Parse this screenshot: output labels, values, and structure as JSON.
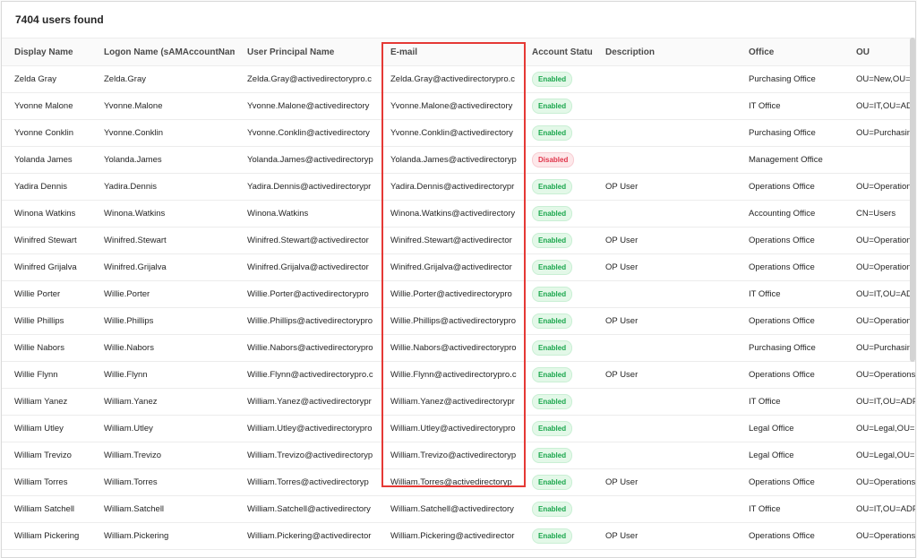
{
  "header": {
    "results_count": "7404 users found"
  },
  "columns": [
    "Display Name",
    "Logon Name (sAMAccountName",
    "User Principal Name",
    "E-mail",
    "Account Statu",
    "Description",
    "Office",
    "OU"
  ],
  "colors": {
    "highlight": "#e53935",
    "enabled": "#1aa64c",
    "disabled": "#e0354b"
  },
  "rows": [
    {
      "display": "Zelda Gray",
      "logon": "Zelda.Gray",
      "upn": "Zelda.Gray@activedirectorypro.c",
      "email": "Zelda.Gray@activedirectorypro.c",
      "status": "Enabled",
      "description": "",
      "office": "Purchasing Office",
      "ou": "OU=New,OU=F"
    },
    {
      "display": "Yvonne Malone",
      "logon": "Yvonne.Malone",
      "upn": "Yvonne.Malone@activedirectory",
      "email": "Yvonne.Malone@activedirectory",
      "status": "Enabled",
      "description": "",
      "office": "IT Office",
      "ou": "OU=IT,OU=ADP"
    },
    {
      "display": "Yvonne Conklin",
      "logon": "Yvonne.Conklin",
      "upn": "Yvonne.Conklin@activedirectory",
      "email": "Yvonne.Conklin@activedirectory",
      "status": "Enabled",
      "description": "",
      "office": "Purchasing Office",
      "ou": "OU=Purchasing"
    },
    {
      "display": "Yolanda James",
      "logon": "Yolanda.James",
      "upn": "Yolanda.James@activedirectoryp",
      "email": "Yolanda.James@activedirectoryp",
      "status": "Disabled",
      "description": "",
      "office": "Management Office",
      "ou": ""
    },
    {
      "display": "Yadira Dennis",
      "logon": "Yadira.Dennis",
      "upn": "Yadira.Dennis@activedirectorypr",
      "email": "Yadira.Dennis@activedirectorypr",
      "status": "Enabled",
      "description": "OP User",
      "office": "Operations Office",
      "ou": "OU=Operations"
    },
    {
      "display": "Winona Watkins",
      "logon": "Winona.Watkins",
      "upn": "Winona.Watkins",
      "email": "Winona.Watkins@activedirectory",
      "status": "Enabled",
      "description": "",
      "office": "Accounting Office",
      "ou": "CN=Users"
    },
    {
      "display": "Winifred Stewart",
      "logon": "Winifred.Stewart",
      "upn": "Winifred.Stewart@activedirector",
      "email": "Winifred.Stewart@activedirector",
      "status": "Enabled",
      "description": "OP User",
      "office": "Operations Office",
      "ou": "OU=Operations"
    },
    {
      "display": "Winifred Grijalva",
      "logon": "Winifred.Grijalva",
      "upn": "Winifred.Grijalva@activedirector",
      "email": "Winifred.Grijalva@activedirector",
      "status": "Enabled",
      "description": "OP User",
      "office": "Operations Office",
      "ou": "OU=Operations"
    },
    {
      "display": "Willie Porter",
      "logon": "Willie.Porter",
      "upn": "Willie.Porter@activedirectorypro",
      "email": "Willie.Porter@activedirectorypro",
      "status": "Enabled",
      "description": "",
      "office": "IT Office",
      "ou": "OU=IT,OU=ADP"
    },
    {
      "display": "Willie Phillips",
      "logon": "Willie.Phillips",
      "upn": "Willie.Phillips@activedirectorypro",
      "email": "Willie.Phillips@activedirectorypro",
      "status": "Enabled",
      "description": "OP User",
      "office": "Operations Office",
      "ou": "OU=Operations"
    },
    {
      "display": "Willie Nabors",
      "logon": "Willie.Nabors",
      "upn": "Willie.Nabors@activedirectorypro",
      "email": "Willie.Nabors@activedirectorypro",
      "status": "Enabled",
      "description": "",
      "office": "Purchasing Office",
      "ou": "OU=Purchasing"
    },
    {
      "display": "Willie Flynn",
      "logon": "Willie.Flynn",
      "upn": "Willie.Flynn@activedirectorypro.c",
      "email": "Willie.Flynn@activedirectorypro.c",
      "status": "Enabled",
      "description": "OP User",
      "office": "Operations Office",
      "ou": "OU=Operations"
    },
    {
      "display": "William Yanez",
      "logon": "William.Yanez",
      "upn": "William.Yanez@activedirectorypr",
      "email": "William.Yanez@activedirectorypr",
      "status": "Enabled",
      "description": "",
      "office": "IT Office",
      "ou": "OU=IT,OU=ADP"
    },
    {
      "display": "William Utley",
      "logon": "William.Utley",
      "upn": "William.Utley@activedirectorypro",
      "email": "William.Utley@activedirectorypro",
      "status": "Enabled",
      "description": "",
      "office": "Legal Office",
      "ou": "OU=Legal,OU="
    },
    {
      "display": "William Trevizo",
      "logon": "William.Trevizo",
      "upn": "William.Trevizo@activedirectoryp",
      "email": "William.Trevizo@activedirectoryp",
      "status": "Enabled",
      "description": "",
      "office": "Legal Office",
      "ou": "OU=Legal,OU="
    },
    {
      "display": "William Torres",
      "logon": "William.Torres",
      "upn": "William.Torres@activedirectoryp",
      "email": "William.Torres@activedirectoryp",
      "status": "Enabled",
      "description": "OP User",
      "office": "Operations Office",
      "ou": "OU=Operations"
    },
    {
      "display": "William Satchell",
      "logon": "William.Satchell",
      "upn": "William.Satchell@activedirectory",
      "email": "William.Satchell@activedirectory",
      "status": "Enabled",
      "description": "",
      "office": "IT Office",
      "ou": "OU=IT,OU=ADP"
    },
    {
      "display": "William Pickering",
      "logon": "William.Pickering",
      "upn": "William.Pickering@activedirector",
      "email": "William.Pickering@activedirector",
      "status": "Enabled",
      "description": "OP User",
      "office": "Operations Office",
      "ou": "OU=Operations"
    }
  ]
}
